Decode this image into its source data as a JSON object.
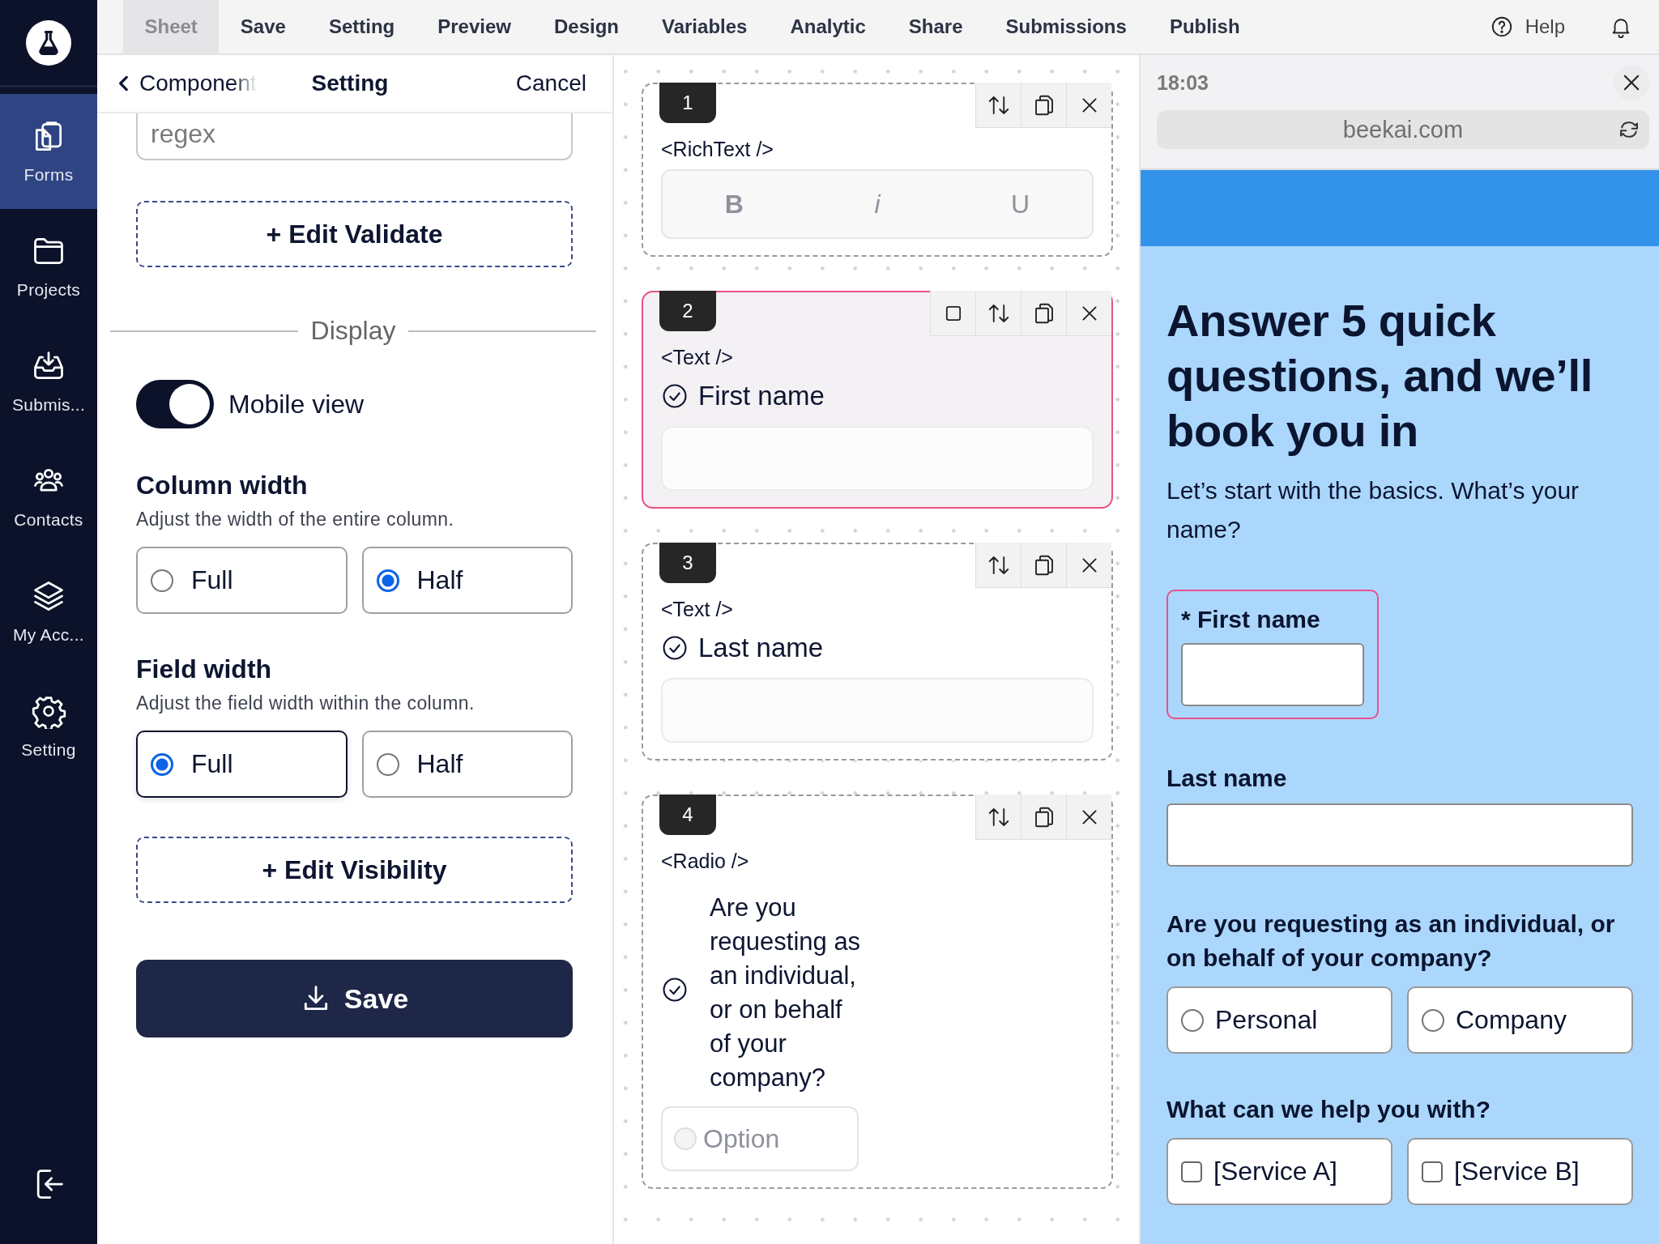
{
  "sidebar": {
    "items": [
      {
        "label": "Forms",
        "selected": true
      },
      {
        "label": "Projects",
        "selected": false
      },
      {
        "label": "Submis...",
        "selected": false
      },
      {
        "label": "Contacts",
        "selected": false
      },
      {
        "label": "My Acc...",
        "selected": false
      },
      {
        "label": "Setting",
        "selected": false
      }
    ]
  },
  "menu": [
    {
      "label": "Sheet",
      "selected": true
    },
    {
      "label": "Save",
      "selected": false
    },
    {
      "label": "Setting",
      "selected": false
    },
    {
      "label": "Preview",
      "selected": false
    },
    {
      "label": "Design",
      "selected": false
    },
    {
      "label": "Variables",
      "selected": false
    },
    {
      "label": "Analytic",
      "selected": false
    },
    {
      "label": "Share",
      "selected": false
    },
    {
      "label": "Submissions",
      "selected": false
    },
    {
      "label": "Publish",
      "selected": false
    }
  ],
  "help": "Help",
  "settings_panel": {
    "back": "Component",
    "title": "Setting",
    "cancel": "Cancel",
    "regex_placeholder": "regex",
    "validate_button": "+ Edit Validate",
    "section": "Display",
    "mobile_view": {
      "label": "Mobile view",
      "on": true
    },
    "groups": [
      {
        "title": "Column width",
        "description": "Adjust the width of the entire column.",
        "options": [
          {
            "label": "Full",
            "selected": false
          },
          {
            "label": "Half",
            "selected": true
          }
        ]
      },
      {
        "title": "Field width",
        "description": "Adjust the field width within the column.",
        "options": [
          {
            "label": "Full",
            "selected": true
          },
          {
            "label": "Half",
            "selected": false
          }
        ]
      }
    ],
    "visibility_button": "+ Edit Visibility",
    "save_button": "Save"
  },
  "canvas": {
    "cards": [
      {
        "number": "1",
        "type": "<RichText />",
        "kind": "richtext",
        "selected": false,
        "toolbar": [
          "B",
          "i",
          "U"
        ]
      },
      {
        "number": "2",
        "type": "<Text />",
        "kind": "text",
        "selected": true,
        "label": "First name"
      },
      {
        "number": "3",
        "type": "<Text />",
        "kind": "text",
        "selected": false,
        "label": "Last name"
      },
      {
        "number": "4",
        "type": "<Radio />",
        "kind": "radio",
        "selected": false,
        "label": "Are you requesting as an individual, or on behalf of your company?",
        "options": [
          {
            "label": "Option",
            "selected": false
          }
        ]
      }
    ]
  },
  "preview": {
    "time": "18:03",
    "url": "beekai.com",
    "title": "Answer 5 quick questions, and we’ll book you in",
    "subtitle": "Let’s start with the basics. What’s your name?",
    "fields": [
      {
        "kind": "text",
        "label": "* First name",
        "half": true,
        "selected": true
      },
      {
        "kind": "text",
        "label": "Last name",
        "half": false,
        "selected": false
      },
      {
        "kind": "radio",
        "label": "Are you requesting as an individual, or on behalf of your company?",
        "options": [
          {
            "label": "Personal",
            "selected": false
          },
          {
            "label": "Company",
            "selected": false
          }
        ]
      },
      {
        "kind": "checkbox",
        "label": "What can we help you with?",
        "options": [
          {
            "label": "[Service A]",
            "checked": false
          },
          {
            "label": "[Service B]",
            "checked": false
          }
        ]
      }
    ]
  }
}
